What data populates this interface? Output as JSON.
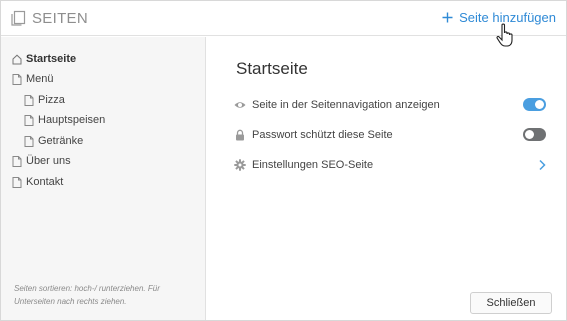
{
  "header": {
    "title": "SEITEN",
    "add_page_label": "Seite hinzufügen"
  },
  "sidebar": {
    "items": [
      {
        "label": "Startseite",
        "icon": "home-icon",
        "active": true
      },
      {
        "label": "Menü",
        "icon": "page-icon"
      },
      {
        "label": "Pizza",
        "icon": "page-icon"
      },
      {
        "label": "Hauptspeisen",
        "icon": "page-icon"
      },
      {
        "label": "Getränke",
        "icon": "page-icon"
      },
      {
        "label": "Über uns",
        "icon": "page-icon"
      },
      {
        "label": "Kontakt",
        "icon": "page-icon"
      }
    ],
    "hint": "Seiten sortieren: hoch-/ runterziehen. Für Unterseiten nach rechts ziehen."
  },
  "main": {
    "title": "Startseite",
    "settings": [
      {
        "label": "Seite in der Seitennavigation anzeigen",
        "icon": "eye-icon",
        "control": "toggle",
        "on": true
      },
      {
        "label": "Passwort schützt diese Seite",
        "icon": "lock-icon",
        "control": "toggle",
        "on": false
      },
      {
        "label": "Einstellungen SEO-Seite",
        "icon": "gear-icon",
        "control": "chevron"
      }
    ],
    "close_label": "Schließen"
  },
  "colors": {
    "accent": "#2f8ad6",
    "toggle_on": "#4a9ee0",
    "toggle_off": "#6f7173"
  }
}
